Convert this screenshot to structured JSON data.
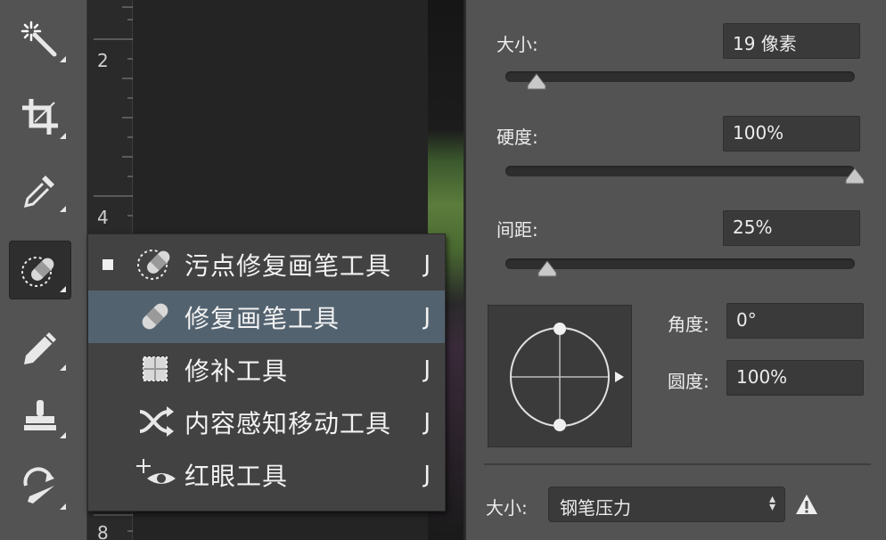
{
  "toolbar": {
    "tools": [
      {
        "name": "magic-wand"
      },
      {
        "name": "crop"
      },
      {
        "name": "eyedropper"
      },
      {
        "name": "spot-healing-brush",
        "active": true
      },
      {
        "name": "brush"
      },
      {
        "name": "clone-stamp"
      },
      {
        "name": "history-brush"
      }
    ]
  },
  "ruler": {
    "marks": [
      "2",
      "4",
      "8"
    ]
  },
  "flyout": {
    "items": [
      {
        "label": "污点修复画笔工具",
        "shortcut": "J",
        "checked": true,
        "highlighted": false,
        "icon": "spot-healing-icon"
      },
      {
        "label": "修复画笔工具",
        "shortcut": "J",
        "checked": false,
        "highlighted": true,
        "icon": "healing-brush-icon"
      },
      {
        "label": "修补工具",
        "shortcut": "J",
        "checked": false,
        "highlighted": false,
        "icon": "patch-icon"
      },
      {
        "label": "内容感知移动工具",
        "shortcut": "J",
        "checked": false,
        "highlighted": false,
        "icon": "content-aware-move-icon"
      },
      {
        "label": "红眼工具",
        "shortcut": "J",
        "checked": false,
        "highlighted": false,
        "icon": "red-eye-icon"
      }
    ]
  },
  "brush_panel": {
    "size_label": "大小:",
    "size_value": "19 像素",
    "size_slider_fraction": 0.09,
    "hardness_label": "硬度:",
    "hardness_value": "100%",
    "hardness_slider_fraction": 1.0,
    "spacing_label": "间距:",
    "spacing_value": "25%",
    "spacing_slider_fraction": 0.12,
    "angle_label": "角度:",
    "angle_value": "0°",
    "roundness_label": "圆度:",
    "roundness_value": "100%",
    "pressure_label": "大小:",
    "pressure_value": "钢笔压力"
  },
  "colors": {
    "panel_bg": "#535353",
    "field_bg": "#3a3a3a",
    "menu_bg": "#424242",
    "menu_highlight": "#53626f"
  }
}
